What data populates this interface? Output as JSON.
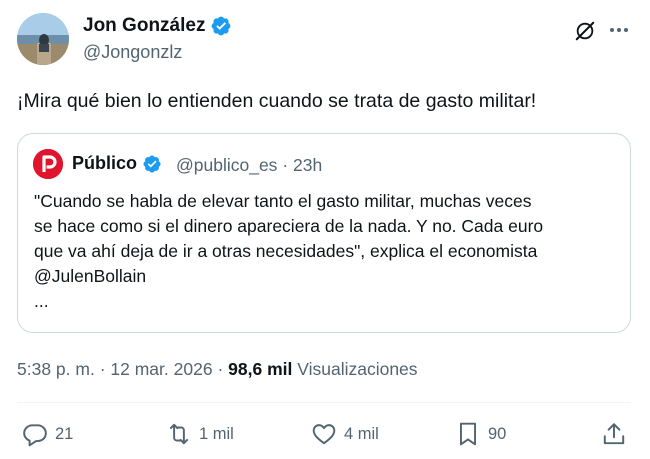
{
  "author": {
    "name": "Jon González",
    "handle": "@Jongonzlz",
    "avatar": "landscape-avatar"
  },
  "tweet": {
    "text": "¡Mira qué bien lo entienden cuando se trata de gasto militar!"
  },
  "quoted": {
    "name": "Público",
    "handle": "@publico_es",
    "separator": "·",
    "time": "23h",
    "lines": [
      "\"Cuando se habla de elevar tanto el gasto militar, muchas veces",
      "se hace como si el dinero apareciera de la nada. Y no. Cada euro",
      "que va ahí deja de ir a otras necesidades\", explica el economista",
      "@JulenBollain",
      "..."
    ],
    "logo_color": "#e1142d"
  },
  "meta": {
    "time": "5:38 p. m.",
    "sep1": "·",
    "date": "12 mar. 2026",
    "sep2": "·",
    "views_count": "98,6 mil",
    "views_label": "Visualizaciones"
  },
  "actions": {
    "replies": "21",
    "reposts": "1 mil",
    "likes": "4 mil",
    "bookmarks": "90"
  },
  "colors": {
    "verified": "#1d9bf0",
    "muted": "#536471",
    "text": "#0f1419",
    "border": "#cfd9de"
  }
}
